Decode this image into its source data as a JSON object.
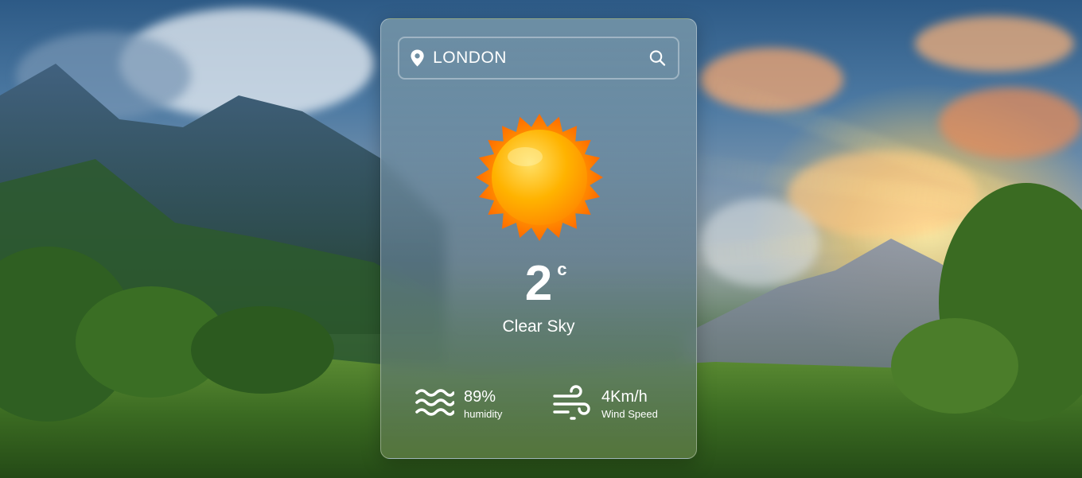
{
  "search": {
    "value": "LONDON",
    "placeholder": "Enter location"
  },
  "weather": {
    "temperature": "2",
    "unit": "c",
    "condition": "Clear Sky",
    "icon": "sun-icon"
  },
  "stats": {
    "humidity": {
      "value": "89%",
      "label": "humidity",
      "icon": "waves-icon"
    },
    "wind": {
      "value": "4Km/h",
      "label": "Wind Speed",
      "icon": "wind-icon"
    }
  },
  "colors": {
    "text": "#ffffff",
    "sun_core": "#ffb000",
    "sun_rays": "#ff7a00"
  }
}
